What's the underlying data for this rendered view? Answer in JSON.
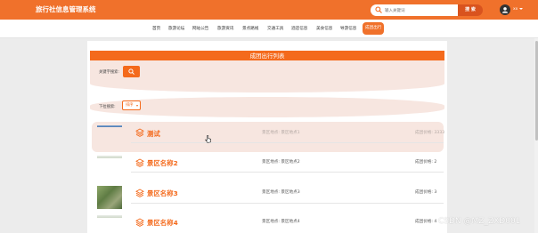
{
  "app": {
    "title": "旅行社信息管理系统"
  },
  "search": {
    "placeholder": "输入关键词",
    "button_label": "搜 索"
  },
  "user": {
    "name": "xx"
  },
  "nav": {
    "items": [
      {
        "label": "首页"
      },
      {
        "label": "旅游论坛"
      },
      {
        "label": "网站公告"
      },
      {
        "label": "旅游资讯"
      },
      {
        "label": "景点路线"
      },
      {
        "label": "交通工具"
      },
      {
        "label": "酒店信息"
      },
      {
        "label": "美食信息"
      },
      {
        "label": "导游信息"
      },
      {
        "label": "成团出行",
        "active": true
      }
    ]
  },
  "panel": {
    "title": "成团出行列表"
  },
  "filters": {
    "keyword_label": "关键字搜索:",
    "sort_label": "下拉搜索:",
    "sort_button": "排序"
  },
  "list": {
    "rows": [
      {
        "title": "测试",
        "location": "景区地点: 景区地点1",
        "price": "成团价格: 3333",
        "highlighted": true,
        "thumb": "blue"
      },
      {
        "title": "景区名称2",
        "location": "景区地点: 景区地点2",
        "price": "成团价格: 2",
        "highlighted": false,
        "thumb": "fade"
      },
      {
        "title": "景区名称3",
        "location": "景区地点: 景区地点3",
        "price": "成团价格: 3",
        "highlighted": false,
        "thumb": "photo"
      },
      {
        "title": "景区名称4",
        "location": "景区地点: 景区地点4",
        "price": "成团价格: 4",
        "highlighted": false,
        "thumb": "fade"
      }
    ]
  },
  "watermark": "CSDN @MZ_ZXD001",
  "colors": {
    "brand": "#f0712b",
    "accent": "#f46a1c",
    "highlight": "#f7e6e0"
  },
  "icons": [
    "search-icon",
    "layers-icon",
    "user-avatar-icon",
    "caret-down-icon",
    "pointer-cursor-icon"
  ]
}
